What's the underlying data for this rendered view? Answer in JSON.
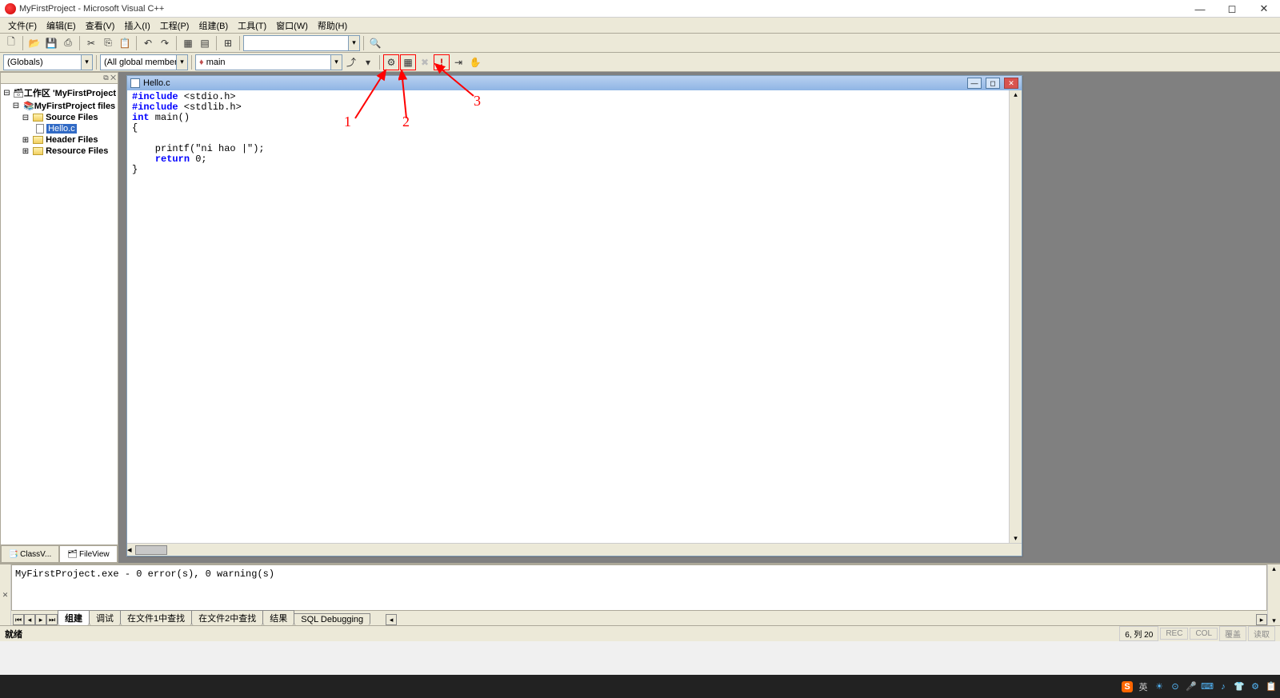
{
  "window": {
    "title": "MyFirstProject - Microsoft Visual C++"
  },
  "menu": {
    "items": [
      "文件(F)",
      "编辑(E)",
      "查看(V)",
      "插入(I)",
      "工程(P)",
      "组建(B)",
      "工具(T)",
      "窗口(W)",
      "帮助(H)"
    ]
  },
  "toolbar2": {
    "combo1": "(Globals)",
    "combo2": "(All global members",
    "combo3": "main",
    "combo3_icon": "♦"
  },
  "workspace": {
    "root": "工作区 'MyFirstProject",
    "project": "MyFirstProject files",
    "folders": {
      "source": "Source Files",
      "header": "Header Files",
      "resource": "Resource Files"
    },
    "file": "Hello.c",
    "tabs": {
      "classview": "ClassV...",
      "fileview": "FileView"
    }
  },
  "editor": {
    "filename": "Hello.c",
    "lines": {
      "l1a": "#include",
      "l1b": " <stdio.h>",
      "l2a": "#include",
      "l2b": " <stdlib.h>",
      "l3a": "int",
      "l3b": " main()",
      "l4": "{",
      "l5": "",
      "l6": "    printf(\"ni hao |\");",
      "l7a": "    ",
      "l7b": "return",
      "l7c": " 0;",
      "l8": "}"
    }
  },
  "output": {
    "text": "MyFirstProject.exe - 0 error(s), 0 warning(s)",
    "tabs": [
      "组建",
      "调试",
      "在文件1中查找",
      "在文件2中查找",
      "结果",
      "SQL Debugging"
    ]
  },
  "status": {
    "ready": "就绪",
    "pos": "6, 列 20",
    "ind": [
      "REC",
      "COL",
      "覆盖",
      "读取"
    ]
  },
  "tray": {
    "ime": "英"
  },
  "annotations": {
    "n1": "1",
    "n2": "2",
    "n3": "3"
  }
}
